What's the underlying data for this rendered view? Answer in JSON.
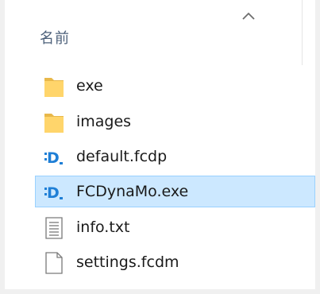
{
  "header": {
    "name_column": "名前",
    "sort_direction": "ascending"
  },
  "files": [
    {
      "name": "exe",
      "icon": "folder-icon",
      "selected": false
    },
    {
      "name": "images",
      "icon": "folder-icon",
      "selected": false
    },
    {
      "name": "default.fcdp",
      "icon": "fcdynamo-icon",
      "selected": false
    },
    {
      "name": "FCDynaMo.exe",
      "icon": "fcdynamo-icon",
      "selected": true
    },
    {
      "name": "info.txt",
      "icon": "text-file-icon",
      "selected": false
    },
    {
      "name": "settings.fcdm",
      "icon": "blank-file-icon",
      "selected": false
    }
  ],
  "colors": {
    "selection_bg": "#cce8ff",
    "selection_border": "#99d1ff",
    "folder": "#ffd56b",
    "app_icon_blue": "#1f7fd6"
  }
}
